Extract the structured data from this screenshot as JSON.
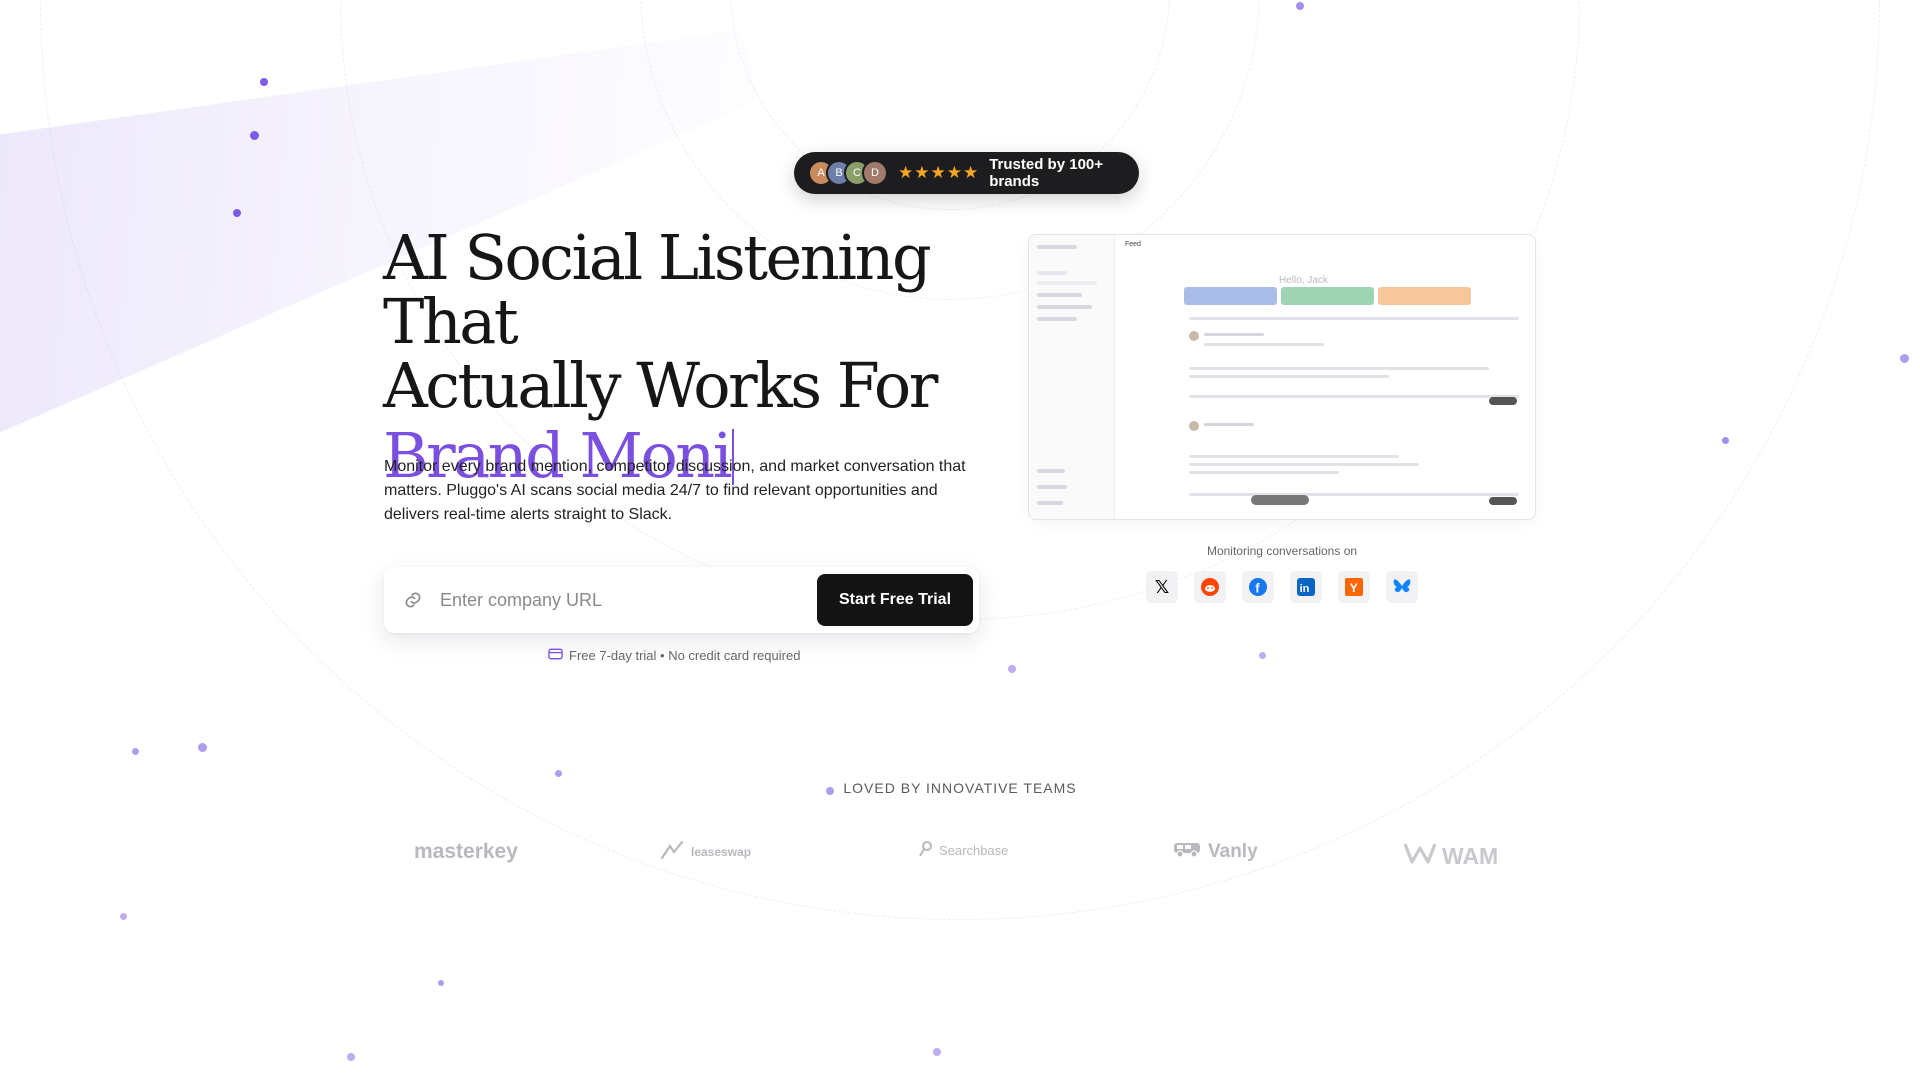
{
  "badge": {
    "stars": "★★★★★",
    "text": "Trusted by 100+ brands",
    "avatars": [
      "A",
      "B",
      "C",
      "D"
    ]
  },
  "hero": {
    "headline_line1": "AI Social Listening That",
    "headline_line2": "Actually Works For",
    "headline_accent": "Brand Moni",
    "description": "Monitor every brand mention, competitor discussion, and market conversation that matters. Pluggo's AI scans social media 24/7 to find relevant opportunities and delivers real-time alerts straight to Slack."
  },
  "signup": {
    "placeholder": "Enter company URL",
    "cta_label": "Start Free Trial",
    "trial_note": "Free 7-day trial • No credit card required"
  },
  "preview": {
    "title": "Feed",
    "greeting": "Hello, Jack"
  },
  "monitoring": {
    "label": "Monitoring conversations on",
    "platforms": [
      {
        "icon": "x-icon",
        "glyph": "𝕏",
        "color": "#000000"
      },
      {
        "icon": "reddit-icon",
        "glyph": "●",
        "color": "#ff4500"
      },
      {
        "icon": "facebook-icon",
        "glyph": "f",
        "color": "#1877f2"
      },
      {
        "icon": "linkedin-icon",
        "glyph": "in",
        "color": "#0a66c2"
      },
      {
        "icon": "hackernews-icon",
        "glyph": "Y",
        "color": "#ff6600"
      },
      {
        "icon": "bluesky-icon",
        "glyph": "🦋",
        "color": "#1185fe"
      }
    ]
  },
  "logos": {
    "heading": "LOVED BY INNOVATIVE TEAMS",
    "items": [
      "masterkey",
      "leaseswap",
      "Searchbase",
      "Vanly",
      "WAM"
    ]
  },
  "colors": {
    "accent": "#7b4fe0",
    "dark": "#141414",
    "star": "#f5a623"
  }
}
